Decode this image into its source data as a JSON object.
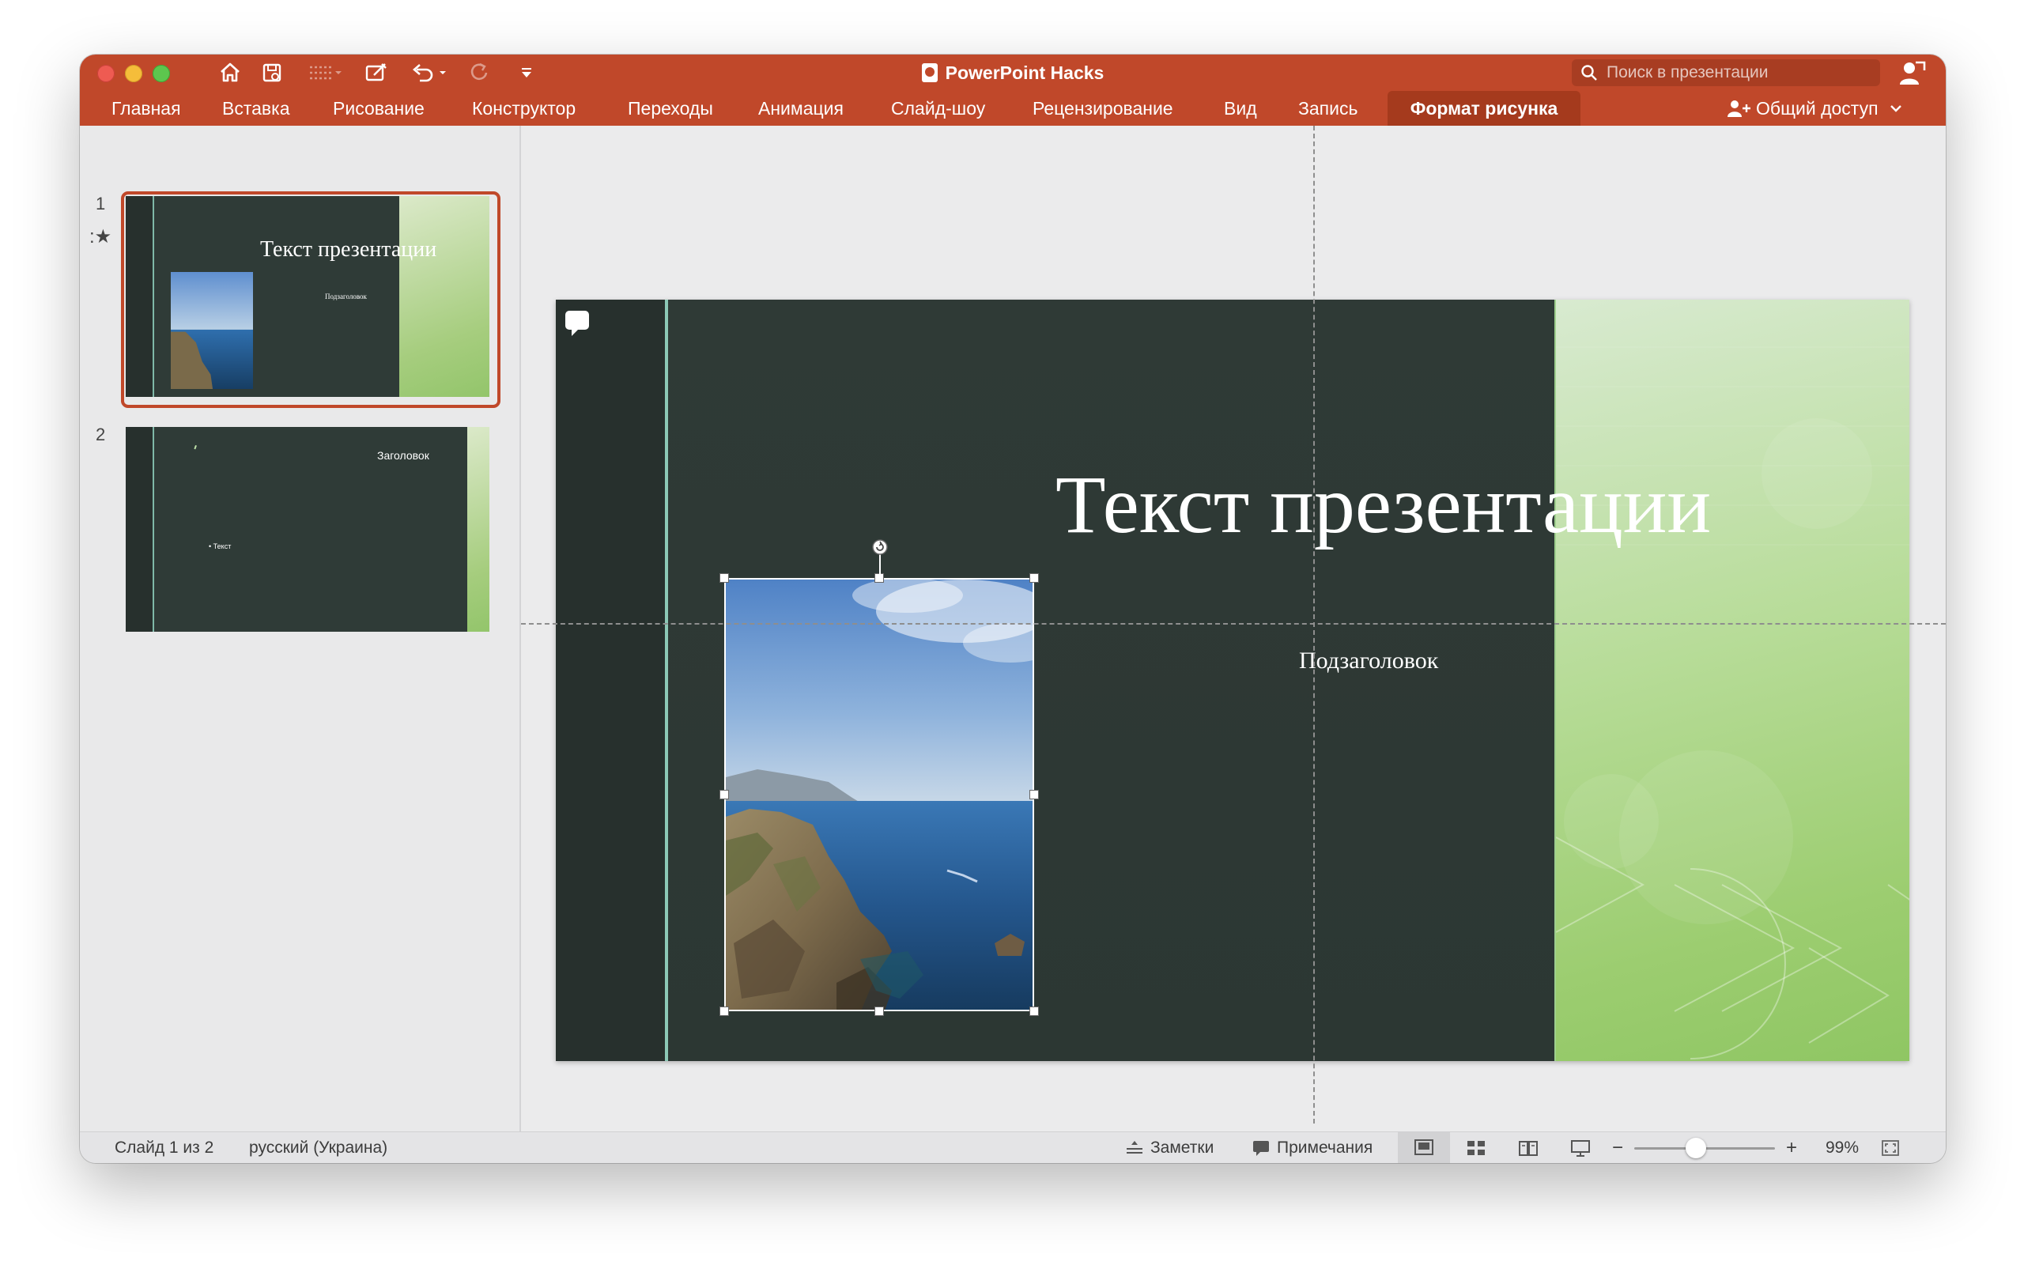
{
  "app": {
    "document_title": "PowerPoint Hacks",
    "search_placeholder": "Поиск в презентации"
  },
  "ribbon": {
    "tabs": [
      {
        "label": "Главная"
      },
      {
        "label": "Вставка"
      },
      {
        "label": "Рисование"
      },
      {
        "label": "Конструктор"
      },
      {
        "label": "Переходы"
      },
      {
        "label": "Анимация"
      },
      {
        "label": "Слайд-шоу"
      },
      {
        "label": "Рецензирование"
      },
      {
        "label": "Вид"
      },
      {
        "label": "Запись"
      },
      {
        "label": "Формат рисунка",
        "active": true
      }
    ],
    "share_label": "Общий доступ"
  },
  "quick_access": {
    "icons": [
      "home-icon",
      "save-icon",
      "list-icon",
      "edit-icon",
      "undo-icon",
      "redo-icon",
      "customize-icon"
    ]
  },
  "thumbnails": [
    {
      "number": "1",
      "title": "Текст презентации",
      "subtitle": "Подзаголовок",
      "selected": true,
      "has_animation": true
    },
    {
      "number": "2",
      "title": "Заголовок",
      "bullet": "Текст",
      "selected": false
    }
  ],
  "slide": {
    "title": "Текст презентации",
    "subtitle": "Подзаголовок",
    "picture": "coastal-cliff-sea-photo"
  },
  "status_bar": {
    "slide_counter": "Слайд 1 из 2",
    "language": "русский (Украина)",
    "notes_label": "Заметки",
    "comments_label": "Примечания",
    "zoom_minus": "−",
    "zoom_plus": "+",
    "zoom_level": "99%",
    "zoom_fraction": 0.44
  },
  "colors": {
    "ribbon": "#c0482a",
    "active_tab": "#a53a1d",
    "slide_background": "#2f3a36",
    "slide_accent": "#8cc8b6",
    "slide_green": "#9ccd70",
    "selection_border": "#c0482a"
  }
}
